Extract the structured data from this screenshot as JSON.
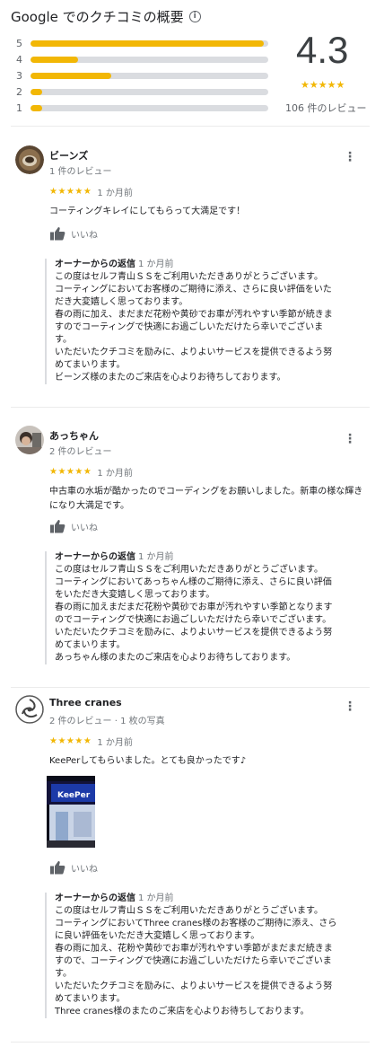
{
  "summary": {
    "title": "Google でのクチコミの概要",
    "rating": "4.3",
    "stars": "★★★★★",
    "review_count": "106 件のレビュー",
    "distribution": [
      {
        "label": "5",
        "fraction": 0.98
      },
      {
        "label": "4",
        "fraction": 0.2
      },
      {
        "label": "3",
        "fraction": 0.34
      },
      {
        "label": "2",
        "fraction": 0.05
      },
      {
        "label": "1",
        "fraction": 0.05
      }
    ]
  },
  "like_label": "いいね",
  "reviews": [
    {
      "author": "ビーンズ",
      "meta": "1 件のレビュー",
      "stars": "★★★★★",
      "time": "1 か月前",
      "text": "コーティングキレイにしてもらって大満足です！",
      "owner_title": "オーナーからの返信",
      "owner_time": "1 か月前",
      "owner_text": [
        "この度はセルフ青山ＳＳをご利用いただきありがとうございます。",
        "コーティングにおいてお客様のご期待に添え、さらに良い評価をいた",
        "だき大変嬉しく思っております。",
        "春の雨に加え、まだまだ花粉や黄砂でお車が汚れやすい季節が続きま",
        "すのでコーティングで快適にお過ごしいただけたら幸いでございま",
        "す。",
        "いただいたクチコミを励みに、よりよいサービスを提供できるよう努",
        "めてまいります。",
        "ビーンズ様のまたのご来店を心よりお待ちしております。"
      ]
    },
    {
      "author": "あっちゃん",
      "meta": "2 件のレビュー",
      "stars": "★★★★★",
      "time": "1 か月前",
      "text": "中古車の水垢が酷かったのでコーディングをお願いしました。新車の様な輝きになり大満足です。",
      "owner_title": "オーナーからの返信",
      "owner_time": "1 か月前",
      "owner_text": [
        "この度はセルフ青山ＳＳをご利用いただきありがとうございます。",
        "コーティングにおいてあっちゃん様のご期待に添え、さらに良い評価",
        "をいただき大変嬉しく思っております。",
        "春の雨に加えまだまだ花粉や黄砂でお車が汚れやすい季節となります",
        "のでコーティングで快適にお過ごしいただけたら幸いでございます。",
        "いただいたクチコミを励みに、よりよいサービスを提供できるよう努",
        "めてまいります。",
        "あっちゃん様のまたのご来店を心よりお待ちしております。"
      ]
    },
    {
      "author": "Three cranes",
      "meta": "2 件のレビュー · 1 枚の写真",
      "stars": "★★★★★",
      "time": "1 か月前",
      "text": "KeePerしてもらいました。とても良かったです♪",
      "photo_sign": "KeePer",
      "owner_title": "オーナーからの返信",
      "owner_time": "1 か月前",
      "owner_text": [
        "この度はセルフ青山ＳＳをご利用いただきありがとうございます。",
        "コーティングにおいてThree cranes様のお客様のご期待に添え、さら",
        "に良い評価をいただき大変嬉しく思っております。",
        "春の雨に加え、花粉や黄砂でお車が汚れやすい季節がまだまだ続きま",
        "すので、コーティングで快適にお過ごしいただけたら幸いでございま",
        "す。",
        "いただいたクチコミを励みに、よりよいサービスを提供できるよう努",
        "めてまいります。",
        "Three cranes様のまたのご来店を心よりお待ちしております。"
      ]
    }
  ]
}
